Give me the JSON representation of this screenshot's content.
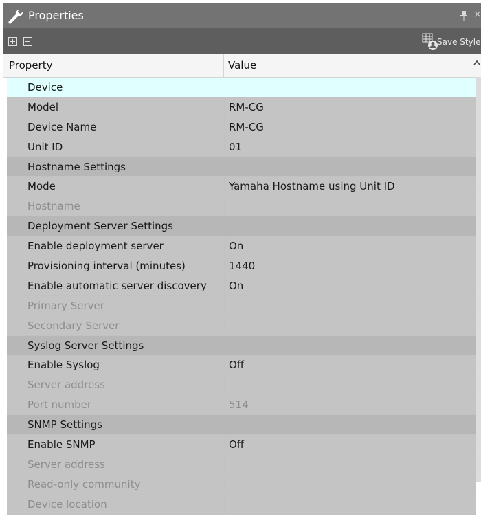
{
  "panel": {
    "title": "Properties",
    "pin_glyph": "⬇",
    "close_glyph": "×"
  },
  "toolbar": {
    "save_style_label": "Save Style"
  },
  "header": {
    "property": "Property",
    "value": "Value"
  },
  "rows": [
    {
      "type": "cat",
      "name": "Device",
      "selected": true
    },
    {
      "type": "prop",
      "name": "Model",
      "value": "RM-CG"
    },
    {
      "type": "prop",
      "name": "Device Name",
      "value": "RM-CG"
    },
    {
      "type": "prop",
      "name": "Unit ID",
      "value": "01"
    },
    {
      "type": "cat",
      "name": "Hostname Settings"
    },
    {
      "type": "prop",
      "name": "Mode",
      "value": "Yamaha Hostname using Unit ID"
    },
    {
      "type": "prop",
      "name": "Hostname",
      "value": "",
      "disabled": true
    },
    {
      "type": "cat",
      "name": "Deployment Server Settings"
    },
    {
      "type": "prop",
      "name": "Enable deployment server",
      "value": "On"
    },
    {
      "type": "prop",
      "name": "Provisioning interval (minutes)",
      "value": "1440"
    },
    {
      "type": "prop",
      "name": "Enable automatic server discovery",
      "value": "On"
    },
    {
      "type": "prop",
      "name": "Primary Server",
      "value": "",
      "disabled": true
    },
    {
      "type": "prop",
      "name": "Secondary Server",
      "value": "",
      "disabled": true
    },
    {
      "type": "cat",
      "name": "Syslog Server Settings"
    },
    {
      "type": "prop",
      "name": "Enable Syslog",
      "value": "Off"
    },
    {
      "type": "prop",
      "name": "Server address",
      "value": "",
      "disabled": true
    },
    {
      "type": "prop",
      "name": "Port number",
      "value": "514",
      "disabled": true
    },
    {
      "type": "cat",
      "name": "SNMP Settings"
    },
    {
      "type": "prop",
      "name": "Enable SNMP",
      "value": "Off"
    },
    {
      "type": "prop",
      "name": "Server address",
      "value": "",
      "disabled": true
    },
    {
      "type": "prop",
      "name": "Read-only community",
      "value": "",
      "disabled": true
    },
    {
      "type": "prop",
      "name": "Device location",
      "value": "",
      "disabled": true
    }
  ],
  "icons": {
    "title": "wrench-icon",
    "pin": "pin-icon",
    "close": "close-icon",
    "expand": "expand-all-icon",
    "collapse": "collapse-all-icon",
    "save_style": "save-style-icon",
    "scroll_up": "scroll-up-arrow-icon"
  },
  "colors": {
    "title_bar": "#737373",
    "toolbar": "#5e5e5e",
    "category_row": "#b7b7b7",
    "property_row": "#c4c4c4",
    "selected_row": "#e0ffff",
    "disabled_text": "#8d8d8d"
  }
}
